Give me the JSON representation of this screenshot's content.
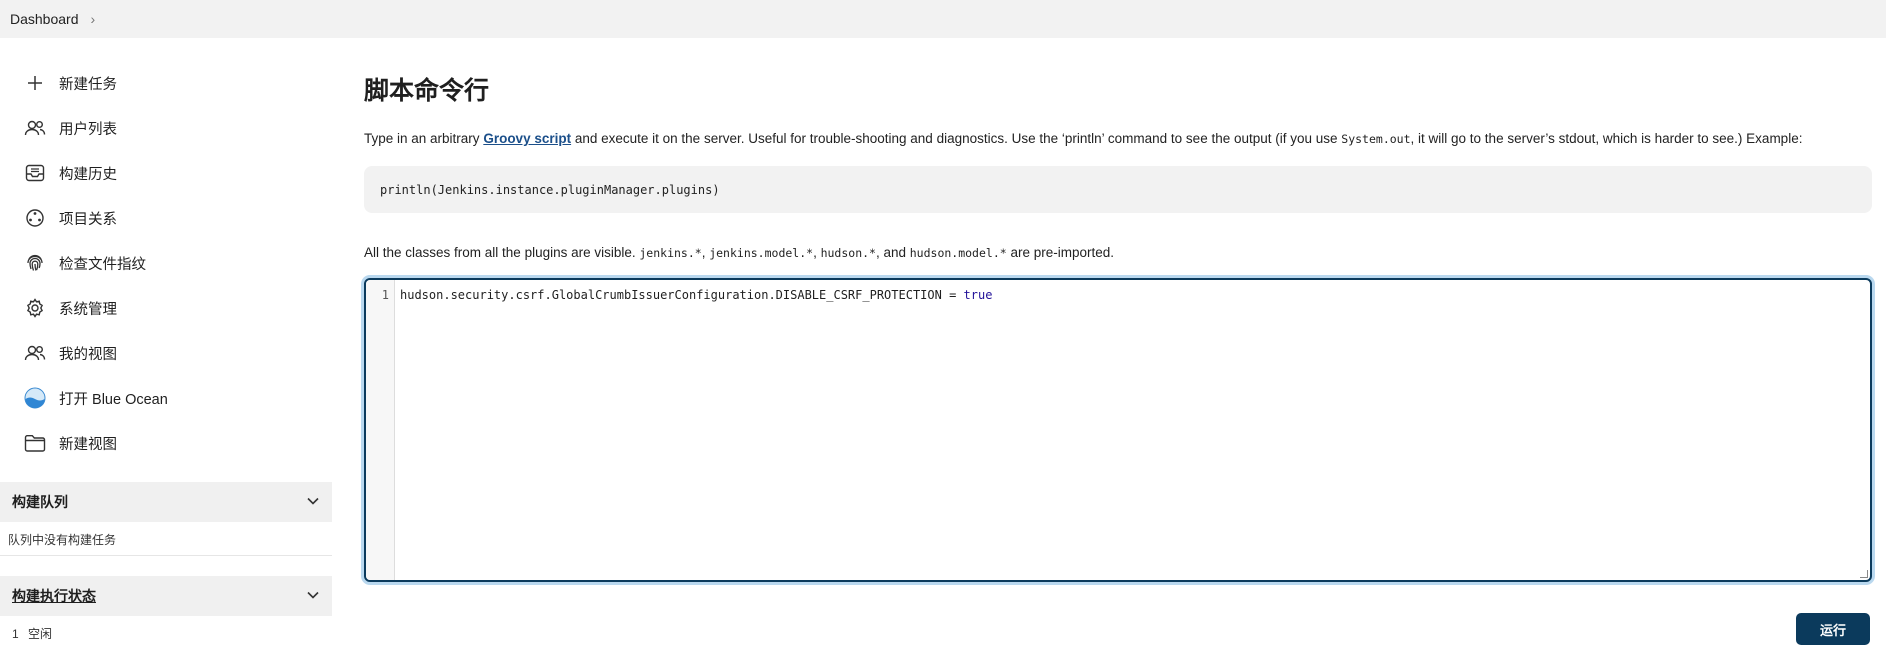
{
  "breadcrumb": {
    "items": [
      "Dashboard"
    ]
  },
  "sidebar": {
    "tasks": [
      {
        "label": "新建任务",
        "icon": "plus-icon"
      },
      {
        "label": "用户列表",
        "icon": "users-icon"
      },
      {
        "label": "构建历史",
        "icon": "inbox-icon"
      },
      {
        "label": "项目关系",
        "icon": "relationship-icon"
      },
      {
        "label": "检查文件指纹",
        "icon": "fingerprint-icon"
      },
      {
        "label": "系统管理",
        "icon": "gear-icon"
      },
      {
        "label": "我的视图",
        "icon": "users-icon"
      },
      {
        "label": "打开 Blue Ocean",
        "icon": "blue-ocean-icon"
      },
      {
        "label": "新建视图",
        "icon": "folder-icon"
      }
    ],
    "build_queue": {
      "title": "构建队列",
      "empty_text": "队列中没有构建任务"
    },
    "executors": {
      "title": "构建执行状态",
      "number": "1",
      "status": "空闲"
    }
  },
  "main": {
    "title": "脚本命令行",
    "desc_before": "Type in an arbitrary ",
    "desc_link": "Groovy script",
    "desc_mid": " and execute it on the server. Useful for trouble-shooting and diagnostics. Use the ‘println’ command to see the output (if you use ",
    "desc_code": "System.out",
    "desc_after": ", it will go to the server’s stdout, which is harder to see.) Example:",
    "example": "println(Jenkins.instance.pluginManager.plugins)",
    "note_before": "All the classes from all the plugins are visible. ",
    "note_code1": "jenkins.*",
    "note_sep1": ", ",
    "note_code2": "jenkins.model.*",
    "note_sep2": ", ",
    "note_code3": "hudson.*",
    "note_sep3": ", and ",
    "note_code4": "hudson.model.*",
    "note_after": " are pre-imported.",
    "editor": {
      "line_number": "1",
      "code_text": "hudson.security.csrf.GlobalCrumbIssuerConfiguration.DISABLE_CSRF_PROTECTION = ",
      "code_keyword": "true"
    },
    "run_label": "运行"
  },
  "colors": {
    "accent": "#0b3a5c",
    "link": "#1b4f8a",
    "panel_bg": "#f0f0f0"
  }
}
